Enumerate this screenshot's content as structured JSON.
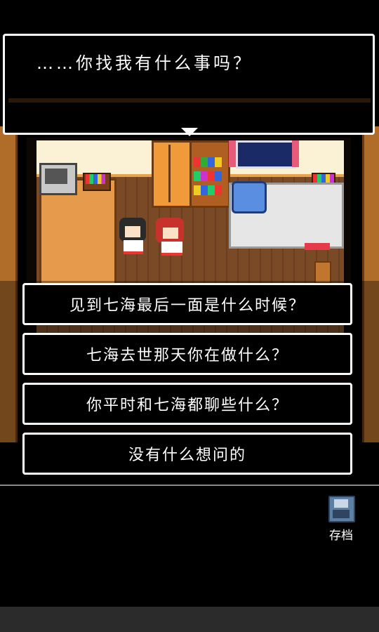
{
  "dialogue": {
    "text": "……你找我有什么事吗？"
  },
  "choices": [
    {
      "label": "见到七海最后一面是什么时候？"
    },
    {
      "label": "七海去世那天你在做什么？"
    },
    {
      "label": "你平时和七海都聊些什么？"
    },
    {
      "label": "没有什么想问的"
    }
  ],
  "toolbar": {
    "save_label": "存档",
    "save_icon": "floppy-disk-icon"
  },
  "colors": {
    "background": "#000000",
    "box_border": "#ffffff",
    "text": "#ffffff",
    "save_icon": "#5d7fa4"
  }
}
